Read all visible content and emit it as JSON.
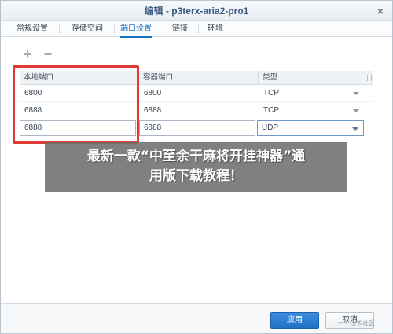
{
  "window": {
    "title": "编辑 - p3terx-aria2-pro1"
  },
  "tabs": [
    {
      "label": "常规设置"
    },
    {
      "label": "存储空间"
    },
    {
      "label": "端口设置"
    },
    {
      "label": "链接"
    },
    {
      "label": "环境"
    }
  ],
  "toolbar": {
    "add_label": "+",
    "remove_label": "−"
  },
  "grid": {
    "headers": [
      "本地端口",
      "容器端口",
      "类型"
    ],
    "rows": [
      {
        "local": "6800",
        "container": "6800",
        "type": "TCP"
      },
      {
        "local": "6888",
        "container": "6888",
        "type": "TCP"
      },
      {
        "local": "6888",
        "container": "6888",
        "type": "UDP"
      }
    ]
  },
  "overlay": {
    "line1": "最新一款“中至余干麻将开挂神器”通",
    "line2": "用版下载教程！"
  },
  "footer": {
    "apply_label": "应用",
    "cancel_label": "取消"
  },
  "watermark": "一个技术社区",
  "colors": {
    "accent": "#1f6fc5",
    "highlight": "#e13a33"
  }
}
